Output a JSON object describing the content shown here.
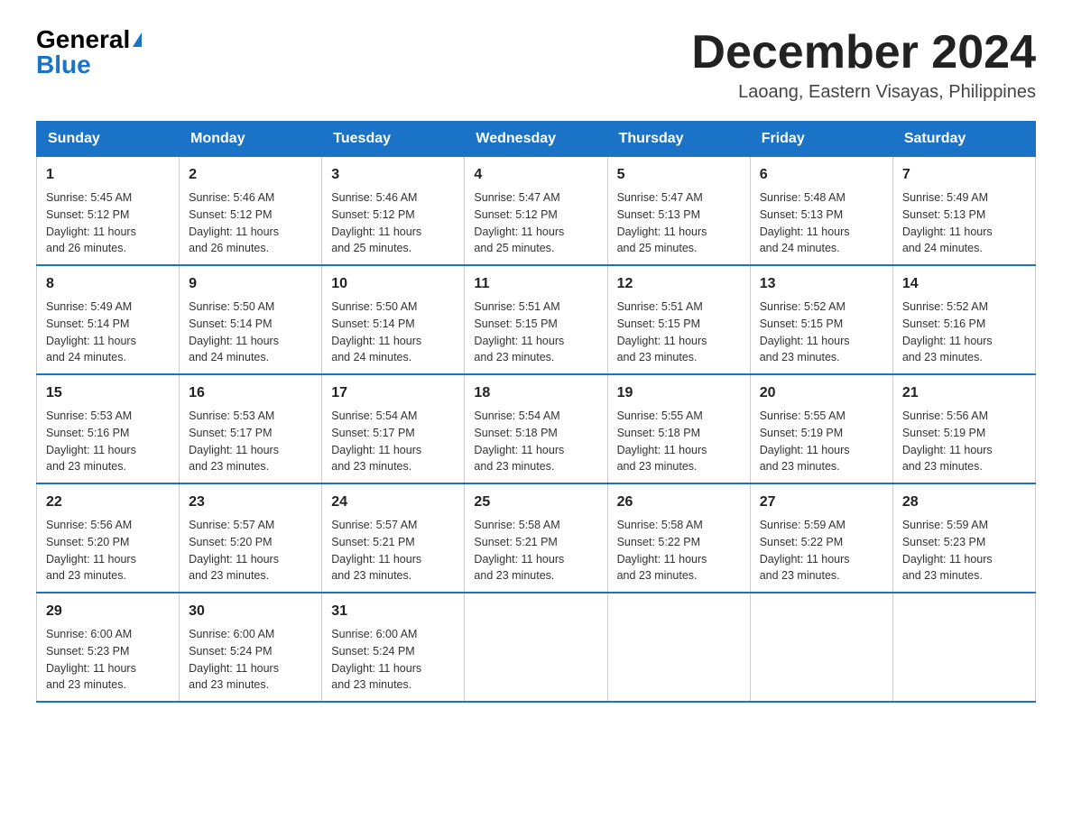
{
  "logo": {
    "general": "General",
    "blue": "Blue"
  },
  "title": "December 2024",
  "subtitle": "Laoang, Eastern Visayas, Philippines",
  "days_of_week": [
    "Sunday",
    "Monday",
    "Tuesday",
    "Wednesday",
    "Thursday",
    "Friday",
    "Saturday"
  ],
  "weeks": [
    [
      {
        "day": "1",
        "sunrise": "5:45 AM",
        "sunset": "5:12 PM",
        "daylight": "11 hours and 26 minutes."
      },
      {
        "day": "2",
        "sunrise": "5:46 AM",
        "sunset": "5:12 PM",
        "daylight": "11 hours and 26 minutes."
      },
      {
        "day": "3",
        "sunrise": "5:46 AM",
        "sunset": "5:12 PM",
        "daylight": "11 hours and 25 minutes."
      },
      {
        "day": "4",
        "sunrise": "5:47 AM",
        "sunset": "5:12 PM",
        "daylight": "11 hours and 25 minutes."
      },
      {
        "day": "5",
        "sunrise": "5:47 AM",
        "sunset": "5:13 PM",
        "daylight": "11 hours and 25 minutes."
      },
      {
        "day": "6",
        "sunrise": "5:48 AM",
        "sunset": "5:13 PM",
        "daylight": "11 hours and 24 minutes."
      },
      {
        "day": "7",
        "sunrise": "5:49 AM",
        "sunset": "5:13 PM",
        "daylight": "11 hours and 24 minutes."
      }
    ],
    [
      {
        "day": "8",
        "sunrise": "5:49 AM",
        "sunset": "5:14 PM",
        "daylight": "11 hours and 24 minutes."
      },
      {
        "day": "9",
        "sunrise": "5:50 AM",
        "sunset": "5:14 PM",
        "daylight": "11 hours and 24 minutes."
      },
      {
        "day": "10",
        "sunrise": "5:50 AM",
        "sunset": "5:14 PM",
        "daylight": "11 hours and 24 minutes."
      },
      {
        "day": "11",
        "sunrise": "5:51 AM",
        "sunset": "5:15 PM",
        "daylight": "11 hours and 23 minutes."
      },
      {
        "day": "12",
        "sunrise": "5:51 AM",
        "sunset": "5:15 PM",
        "daylight": "11 hours and 23 minutes."
      },
      {
        "day": "13",
        "sunrise": "5:52 AM",
        "sunset": "5:15 PM",
        "daylight": "11 hours and 23 minutes."
      },
      {
        "day": "14",
        "sunrise": "5:52 AM",
        "sunset": "5:16 PM",
        "daylight": "11 hours and 23 minutes."
      }
    ],
    [
      {
        "day": "15",
        "sunrise": "5:53 AM",
        "sunset": "5:16 PM",
        "daylight": "11 hours and 23 minutes."
      },
      {
        "day": "16",
        "sunrise": "5:53 AM",
        "sunset": "5:17 PM",
        "daylight": "11 hours and 23 minutes."
      },
      {
        "day": "17",
        "sunrise": "5:54 AM",
        "sunset": "5:17 PM",
        "daylight": "11 hours and 23 minutes."
      },
      {
        "day": "18",
        "sunrise": "5:54 AM",
        "sunset": "5:18 PM",
        "daylight": "11 hours and 23 minutes."
      },
      {
        "day": "19",
        "sunrise": "5:55 AM",
        "sunset": "5:18 PM",
        "daylight": "11 hours and 23 minutes."
      },
      {
        "day": "20",
        "sunrise": "5:55 AM",
        "sunset": "5:19 PM",
        "daylight": "11 hours and 23 minutes."
      },
      {
        "day": "21",
        "sunrise": "5:56 AM",
        "sunset": "5:19 PM",
        "daylight": "11 hours and 23 minutes."
      }
    ],
    [
      {
        "day": "22",
        "sunrise": "5:56 AM",
        "sunset": "5:20 PM",
        "daylight": "11 hours and 23 minutes."
      },
      {
        "day": "23",
        "sunrise": "5:57 AM",
        "sunset": "5:20 PM",
        "daylight": "11 hours and 23 minutes."
      },
      {
        "day": "24",
        "sunrise": "5:57 AM",
        "sunset": "5:21 PM",
        "daylight": "11 hours and 23 minutes."
      },
      {
        "day": "25",
        "sunrise": "5:58 AM",
        "sunset": "5:21 PM",
        "daylight": "11 hours and 23 minutes."
      },
      {
        "day": "26",
        "sunrise": "5:58 AM",
        "sunset": "5:22 PM",
        "daylight": "11 hours and 23 minutes."
      },
      {
        "day": "27",
        "sunrise": "5:59 AM",
        "sunset": "5:22 PM",
        "daylight": "11 hours and 23 minutes."
      },
      {
        "day": "28",
        "sunrise": "5:59 AM",
        "sunset": "5:23 PM",
        "daylight": "11 hours and 23 minutes."
      }
    ],
    [
      {
        "day": "29",
        "sunrise": "6:00 AM",
        "sunset": "5:23 PM",
        "daylight": "11 hours and 23 minutes."
      },
      {
        "day": "30",
        "sunrise": "6:00 AM",
        "sunset": "5:24 PM",
        "daylight": "11 hours and 23 minutes."
      },
      {
        "day": "31",
        "sunrise": "6:00 AM",
        "sunset": "5:24 PM",
        "daylight": "11 hours and 23 minutes."
      },
      null,
      null,
      null,
      null
    ]
  ],
  "labels": {
    "sunrise": "Sunrise:",
    "sunset": "Sunset:",
    "daylight": "Daylight:"
  }
}
